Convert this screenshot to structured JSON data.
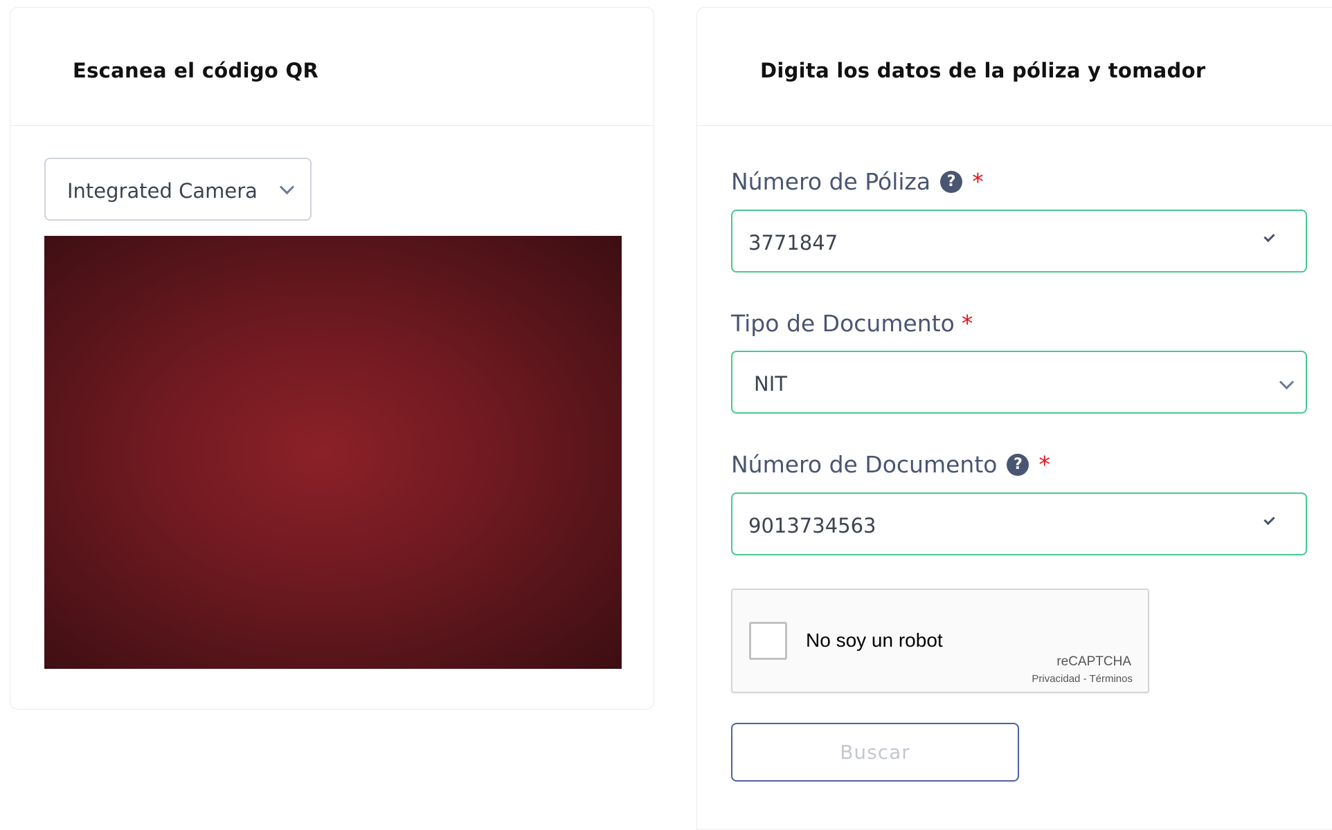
{
  "qr_panel": {
    "title": "Escanea el código QR",
    "camera_select": {
      "selected": "Integrated Camera",
      "icon": "chevron-down-icon"
    },
    "camera_preview": {
      "colors": [
        "#8b2128",
        "#721a21",
        "#55141a",
        "#3c0e12"
      ]
    }
  },
  "policy_panel": {
    "title": "Digita los datos de la póliza y tomador",
    "fields": [
      {
        "label": "Número de Póliza",
        "help_icon": "?",
        "required_mark": "*",
        "value": "3771847",
        "state": "valid"
      },
      {
        "label": "Tipo de Documento",
        "required_mark": "*",
        "value": "NIT",
        "control": "select"
      },
      {
        "label": "Número de Documento",
        "help_icon": "?",
        "required_mark": "*",
        "value": "9013734563",
        "state": "valid"
      }
    ],
    "recaptcha": {
      "label": "No soy un robot",
      "brand": "reCAPTCHA",
      "privacy": "Privacidad",
      "separator": "-",
      "terms": "Términos",
      "checked": false
    },
    "search_button": "Buscar"
  },
  "colors": {
    "valid_border": "#46c98f",
    "required": "#e8141e",
    "label": "#4a5572",
    "button_border": "#4f5fa3",
    "button_text_disabled": "#c3c7d0"
  }
}
